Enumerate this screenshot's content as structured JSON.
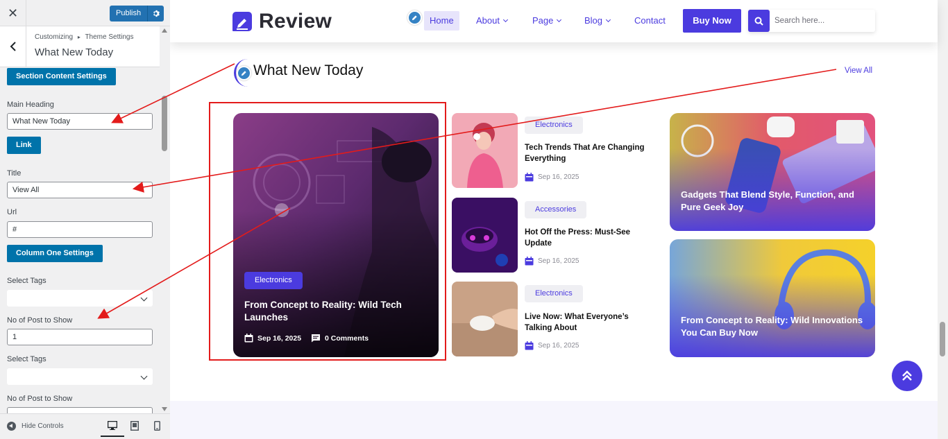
{
  "customizer": {
    "close_icon": "close-icon",
    "publish_label": "Publish",
    "breadcrumb_root": "Customizing",
    "breadcrumb_sep": "▸",
    "breadcrumb_parent": "Theme Settings",
    "section_title": "What New Today",
    "fields": {
      "section_content_button": "Section Content Settings",
      "main_heading_label": "Main Heading",
      "main_heading_value": "What New Today",
      "link_button": "Link",
      "title_label": "Title",
      "title_value": "View All",
      "url_label": "Url",
      "url_value": "#",
      "column_one_button": "Column One Settings",
      "select_tags_label_1": "Select Tags",
      "no_post_label_1": "No of Post to Show",
      "no_post_value_1": "1",
      "select_tags_label_2": "Select Tags",
      "no_post_label_2": "No of Post to Show"
    },
    "hide_controls_label": "Hide Controls"
  },
  "site": {
    "brand": "Review",
    "nav": [
      {
        "label": "Home"
      },
      {
        "label": "About"
      },
      {
        "label": "Page"
      },
      {
        "label": "Blog"
      },
      {
        "label": "Contact"
      }
    ],
    "buy_now": "Buy Now",
    "search_placeholder": "Search here..."
  },
  "section": {
    "heading": "What New Today",
    "view_all": "View All",
    "feature": {
      "category": "Electronics",
      "title": "From Concept to Reality: Wild Tech Launches",
      "date": "Sep 16, 2025",
      "comments": "0 Comments"
    },
    "middle": [
      {
        "category": "Electronics",
        "title": "Tech Trends That Are Changing Everything",
        "date": "Sep 16, 2025"
      },
      {
        "category": "Accessories",
        "title": "Hot Off the Press: Must-See Update",
        "date": "Sep 16, 2025"
      },
      {
        "category": "Electronics",
        "title": "Live Now: What Everyone’s Talking About",
        "date": "Sep 16, 2025"
      }
    ],
    "right": [
      {
        "title": "Gadgets That Blend Style, Function, and Pure Geek Joy"
      },
      {
        "title": "From Concept to Reality: Wild Innovations You Can Buy Now"
      }
    ]
  },
  "colors": {
    "accent": "#4b3bdf",
    "wp_blue": "#0073aa",
    "annotation_red": "#e31b1b"
  }
}
